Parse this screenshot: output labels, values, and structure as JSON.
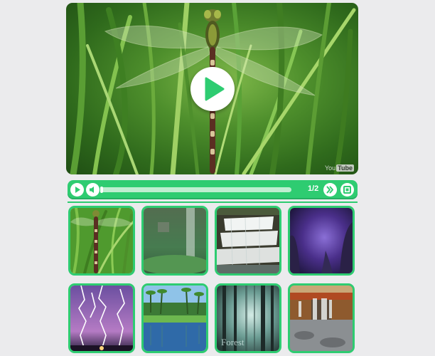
{
  "player": {
    "watermark_you": "You",
    "watermark_tube": "Tube",
    "counter": "1/2",
    "progress": 0.0
  },
  "icons": {
    "big_play": "play-icon",
    "play": "play-icon",
    "mute": "speaker-icon",
    "next": "double-chevron-right-icon",
    "fullscreen": "fullscreen-icon"
  },
  "colors": {
    "accent": "#2ecc71",
    "background": "#ebebed"
  },
  "thumbnails": [
    {
      "scene": "dragonfly"
    },
    {
      "scene": "misty waterfall"
    },
    {
      "scene": "cascade"
    },
    {
      "scene": "purple forest"
    },
    {
      "scene": "lightning"
    },
    {
      "scene": "tropical lake"
    },
    {
      "scene": "forest",
      "caption": "Forest"
    },
    {
      "scene": "autumn falls"
    }
  ]
}
